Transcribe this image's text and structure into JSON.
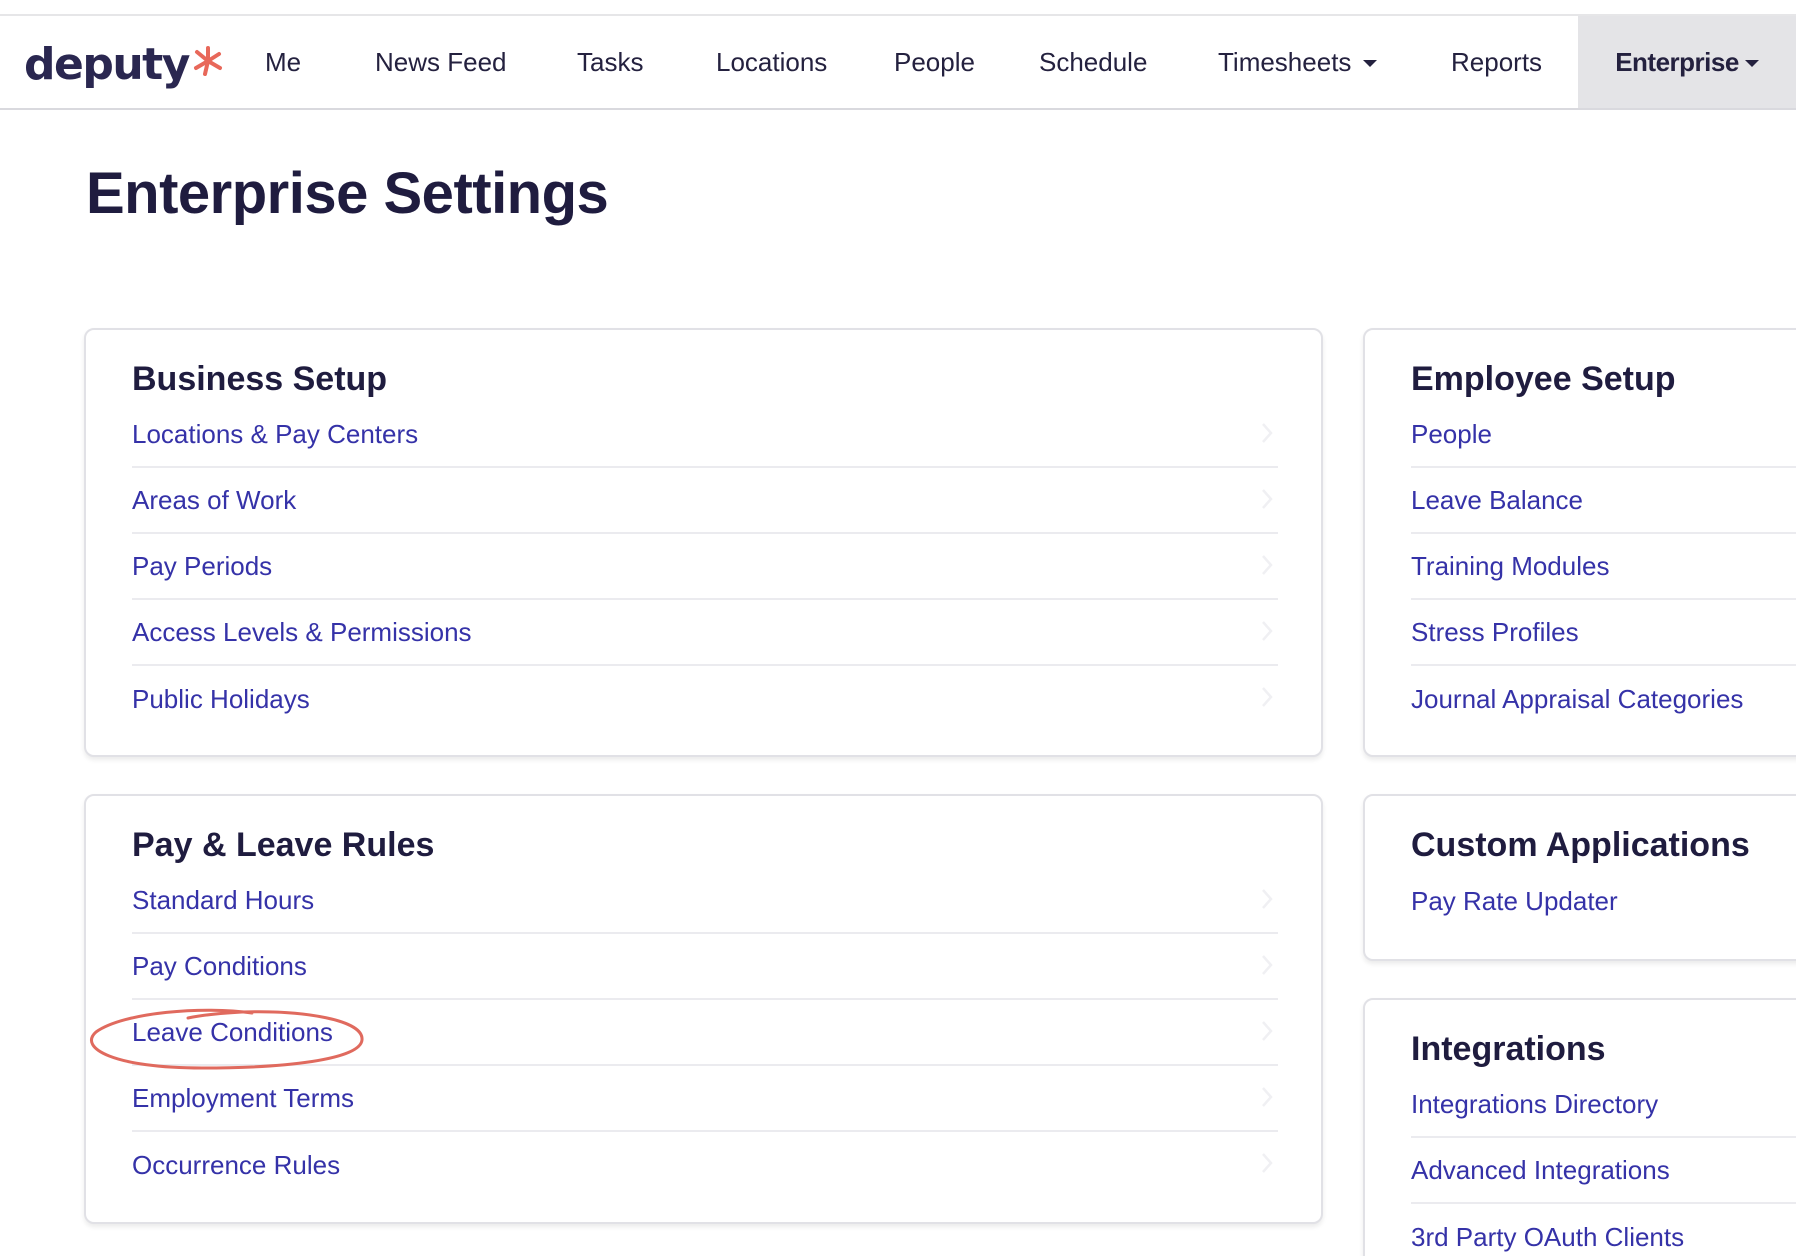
{
  "brand": {
    "logo_text": "deputy",
    "logo_mark": "asterisk-logo-icon",
    "accent_color": "#e8685a"
  },
  "nav": {
    "me": "Me",
    "news_feed": "News Feed",
    "tasks": "Tasks",
    "locations": "Locations",
    "people": "People",
    "schedule": "Schedule",
    "timesheets": "Timesheets",
    "reports": "Reports",
    "enterprise": "Enterprise",
    "active": "Enterprise"
  },
  "page": {
    "title": "Enterprise Settings"
  },
  "business_setup": {
    "title": "Business Setup",
    "items": [
      "Locations & Pay Centers",
      "Areas of Work",
      "Pay Periods",
      "Access Levels & Permissions",
      "Public Holidays"
    ]
  },
  "pay_leave_rules": {
    "title": "Pay & Leave Rules",
    "items": [
      "Standard Hours",
      "Pay Conditions",
      "Leave Conditions",
      "Employment Terms",
      "Occurrence Rules"
    ],
    "highlighted": "Leave Conditions"
  },
  "employee_setup": {
    "title": "Employee Setup",
    "items": [
      "People",
      "Leave Balance",
      "Training Modules",
      "Stress Profiles",
      "Journal Appraisal Categories"
    ]
  },
  "custom_applications": {
    "title": "Custom Applications",
    "items": [
      "Pay Rate Updater"
    ]
  },
  "integrations": {
    "title": "Integrations",
    "items": [
      "Integrations Directory",
      "Advanced Integrations",
      "3rd Party OAuth Clients"
    ]
  },
  "colors": {
    "link": "#3532a8",
    "heading": "#1f1c3f",
    "annotation": "#e06a5e"
  }
}
